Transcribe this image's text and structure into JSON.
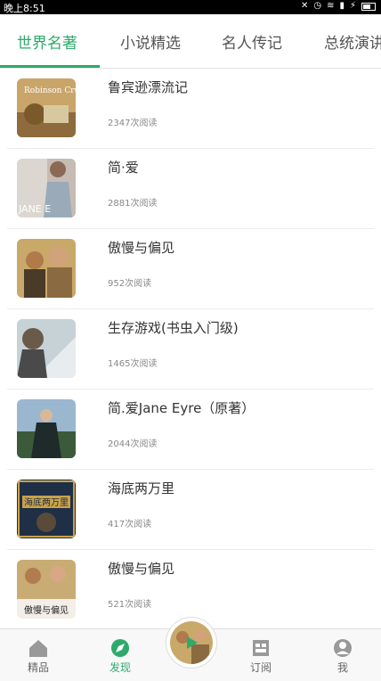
{
  "status_bar": {
    "time": "晚上8:51"
  },
  "tabs": [
    {
      "label": "世界名著"
    },
    {
      "label": "小说精选"
    },
    {
      "label": "名人传记"
    },
    {
      "label": "总统演讲"
    }
  ],
  "books": [
    {
      "title": "鲁宾逊漂流记",
      "reads": "2347次阅读",
      "cover_text": "Robinson Crusoe"
    },
    {
      "title": "简·爱",
      "reads": "2881次阅读",
      "cover_text": "JANE E"
    },
    {
      "title": "傲慢与偏见",
      "reads": "952次阅读"
    },
    {
      "title": "生存游戏(书虫入门级)",
      "reads": "1465次阅读"
    },
    {
      "title": "简.爱Jane Eyre（原著）",
      "reads": "2044次阅读"
    },
    {
      "title": "海底两万里",
      "reads": "417次阅读",
      "cover_text": "海底两万里"
    },
    {
      "title": "傲慢与偏见",
      "reads": "521次阅读",
      "cover_text": "傲慢与偏见"
    }
  ],
  "bottom_nav": [
    {
      "label": "精品",
      "icon": "home-icon"
    },
    {
      "label": "发现",
      "icon": "compass-icon"
    },
    {
      "label": "订阅",
      "icon": "subscribe-icon"
    },
    {
      "label": "我",
      "icon": "profile-icon"
    }
  ],
  "colors": {
    "accent": "#2eaa6b"
  }
}
